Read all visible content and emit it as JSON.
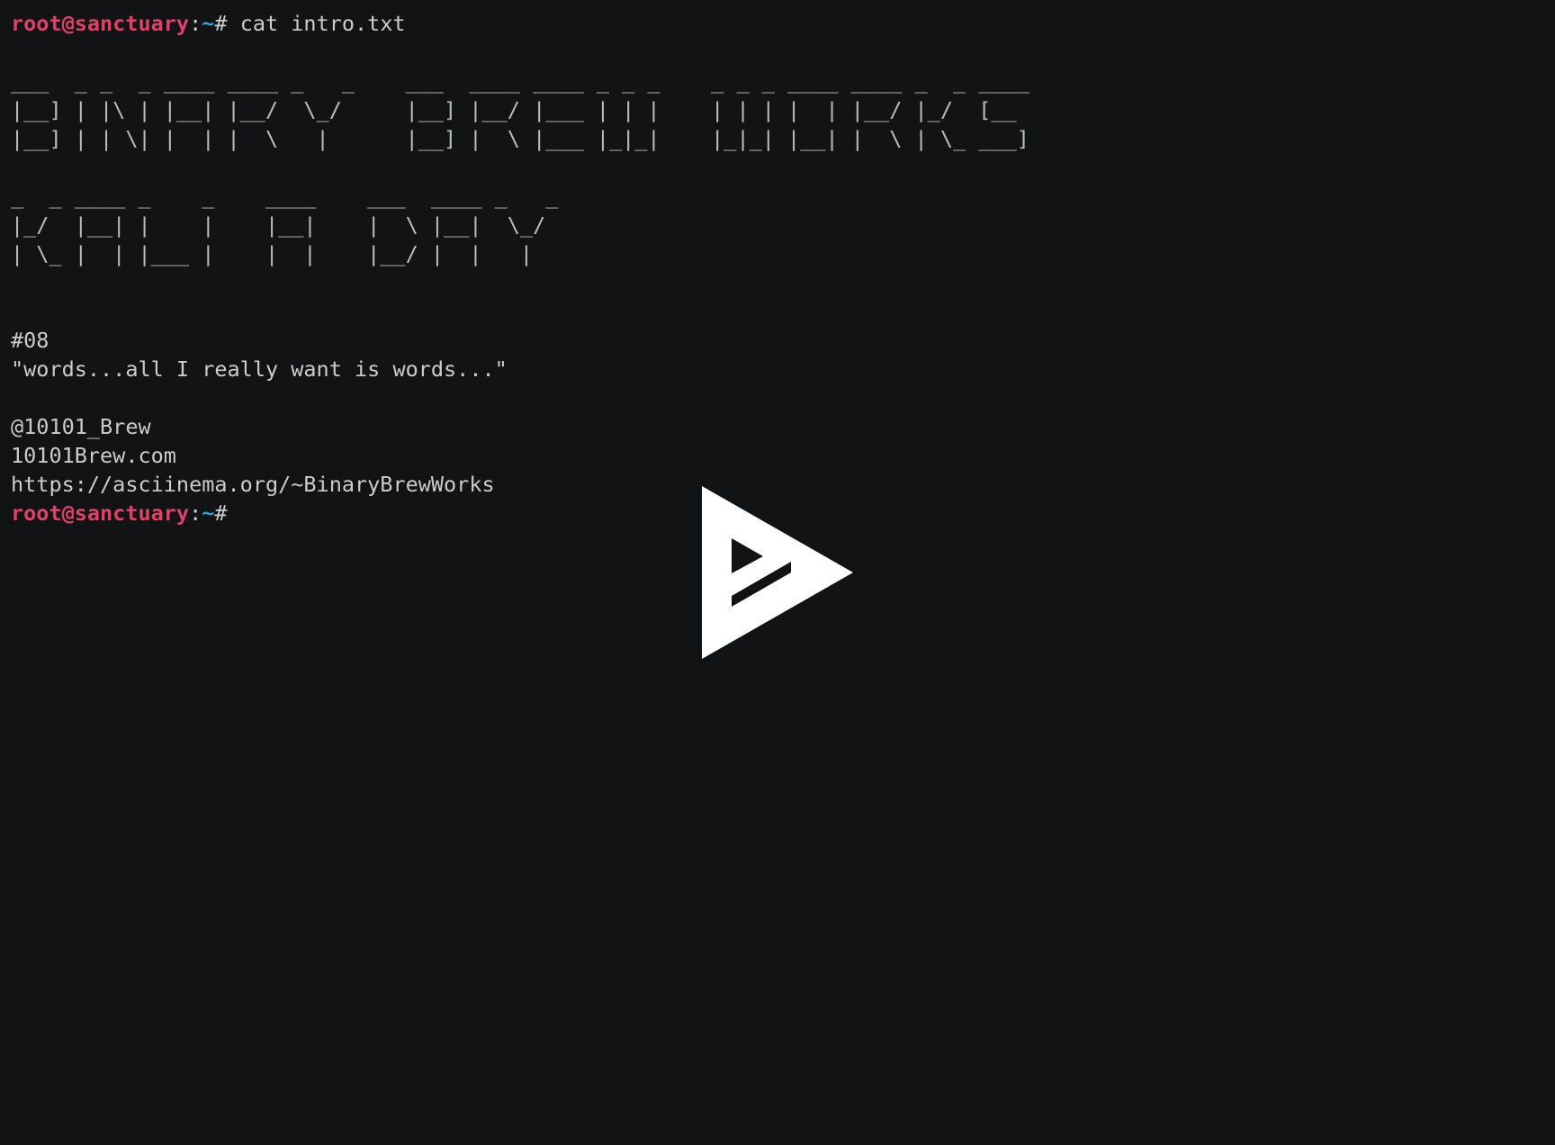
{
  "prompt": {
    "user_host": "root@sanctuary",
    "separator": ":",
    "path": "~",
    "symbol": "#"
  },
  "command": " cat intro.txt",
  "banner": {
    "line1": [
      "___  _ _  _ ____ ____ _   _    ___  ____ ____ _ _ _    _ _ _ ____ ____ _  _ ____",
      "|__] | |\\ | |__| |__/  \\_/     |__] |__/ |___ | | |    | | | |  | |__/ |_/  [__ ",
      "|__] | | \\| |  | |  \\   |      |__] |  \\ |___ |_|_|    |_|_| |__| |  \\ | \\_ ___]"
    ],
    "line2": [
      "_  _ ____ _    _    ____    ___  ____ _   _",
      "|_/  |__| |    |    |__|    |  \\ |__|  \\_/ ",
      "| \\_ |  | |___ |    |  |    |__/ |  |   |  "
    ]
  },
  "episode": "#08",
  "quote": "\"words...all I really want is words...\"",
  "handle": "@10101_Brew",
  "website": "10101Brew.com",
  "profile_url": "https://asciinema.org/~BinaryBrewWorks",
  "player": {
    "icon": "asciinema-play-icon",
    "color": "#ffffff",
    "background": "#121314"
  }
}
